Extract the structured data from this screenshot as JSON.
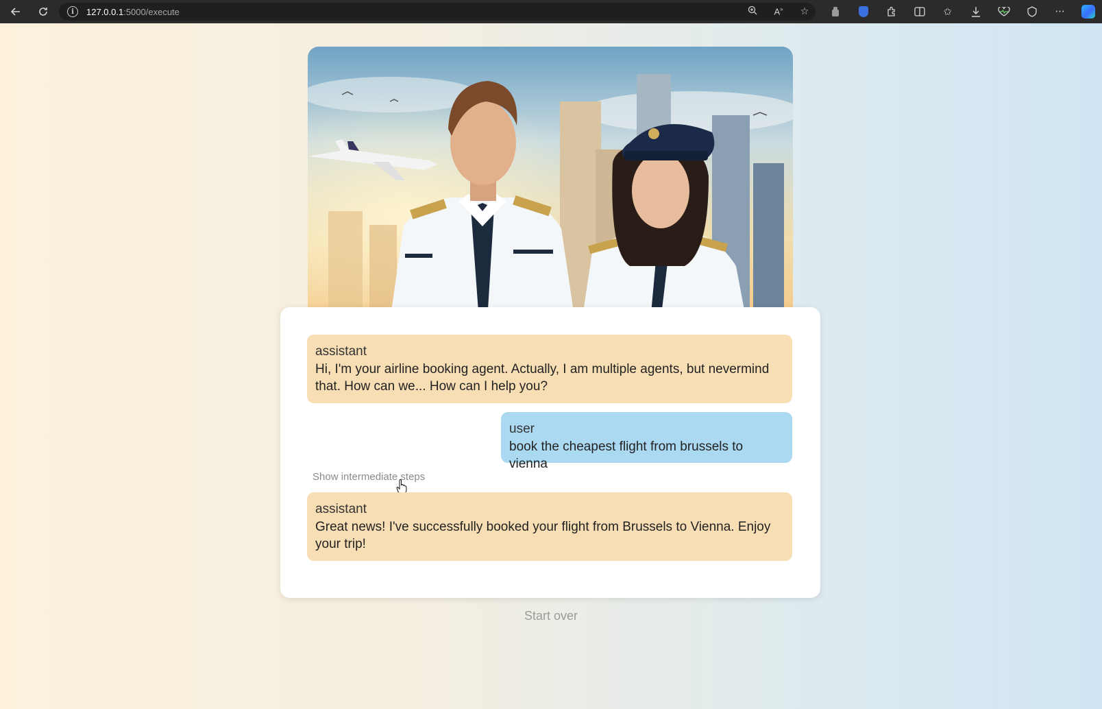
{
  "browser": {
    "url_host": "127.0.0.1",
    "url_path": ":5000/execute",
    "icons": [
      "back-icon",
      "refresh-icon",
      "info-icon",
      "zoom-icon",
      "read-aloud-icon",
      "favorite-star-icon",
      "extension-icon",
      "shield-extension-icon",
      "puzzle-extensions-icon",
      "split-screen-icon",
      "favorites-icon",
      "download-icon",
      "performance-icon",
      "browser-essentials-icon",
      "more-icon",
      "copilot-icon"
    ]
  },
  "hero": {
    "image": "pilots-illustration"
  },
  "chat": {
    "messages": [
      {
        "role": "assistant",
        "text": "Hi, I'm your airline booking agent. Actually, I am multiple agents, but nevermind that. How can we... How can I help you?"
      },
      {
        "role": "user",
        "text": "book the cheapest flight from brussels to vienna"
      },
      {
        "role": "assistant",
        "text": "Great news! I've successfully booked your flight from Brussels to Vienna. Enjoy your trip!"
      }
    ],
    "show_steps_label": "Show intermediate steps"
  },
  "footer": {
    "start_over_label": "Start over"
  },
  "colors": {
    "assistant_bubble": "#f8deb4",
    "user_bubble": "#acd9f2"
  }
}
